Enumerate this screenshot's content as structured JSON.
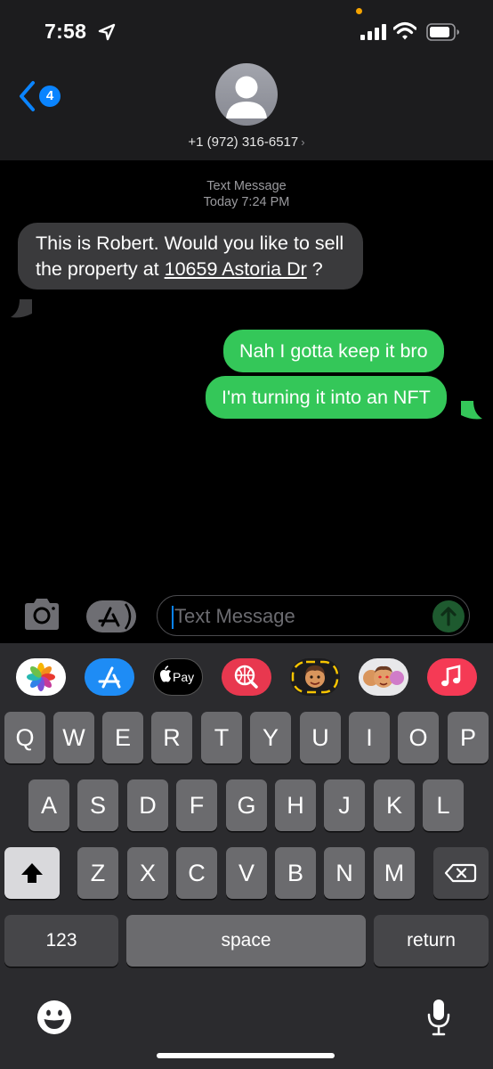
{
  "status_bar": {
    "time": "7:58"
  },
  "header": {
    "back_badge": "4",
    "contact": "+1 (972) 316-6517",
    "chevron": "›"
  },
  "conversation": {
    "service_label": "Text Message",
    "timestamp": "Today 7:24 PM",
    "messages": [
      {
        "direction": "incoming",
        "text_before": "This is Robert. Would you like to sell the property at ",
        "link": "10659 Astoria Dr",
        "text_after": " ?"
      },
      {
        "direction": "outgoing",
        "text": "Nah I gotta keep it bro"
      },
      {
        "direction": "outgoing",
        "text": "I'm turning it into an NFT"
      }
    ]
  },
  "composer": {
    "placeholder": "Text Message"
  },
  "app_bar": {
    "apps": [
      {
        "icon": "photos-icon"
      },
      {
        "icon": "app-store-icon"
      },
      {
        "icon": "apple-pay-icon",
        "label": "Pay"
      },
      {
        "icon": "web-images-icon"
      },
      {
        "icon": "memoji-icon"
      },
      {
        "icon": "memoji-stickers-icon"
      },
      {
        "icon": "music-icon"
      }
    ]
  },
  "keyboard": {
    "row1": [
      "Q",
      "W",
      "E",
      "R",
      "T",
      "Y",
      "U",
      "I",
      "O",
      "P"
    ],
    "row2": [
      "A",
      "S",
      "D",
      "F",
      "G",
      "H",
      "J",
      "K",
      "L"
    ],
    "row3": [
      "Z",
      "X",
      "C",
      "V",
      "B",
      "N",
      "M"
    ],
    "numbers": "123",
    "space": "space",
    "return": "return"
  },
  "colors": {
    "incoming_bubble": "#3a3a3c",
    "outgoing_bubble": "#34c759",
    "accent": "#0a84ff"
  }
}
